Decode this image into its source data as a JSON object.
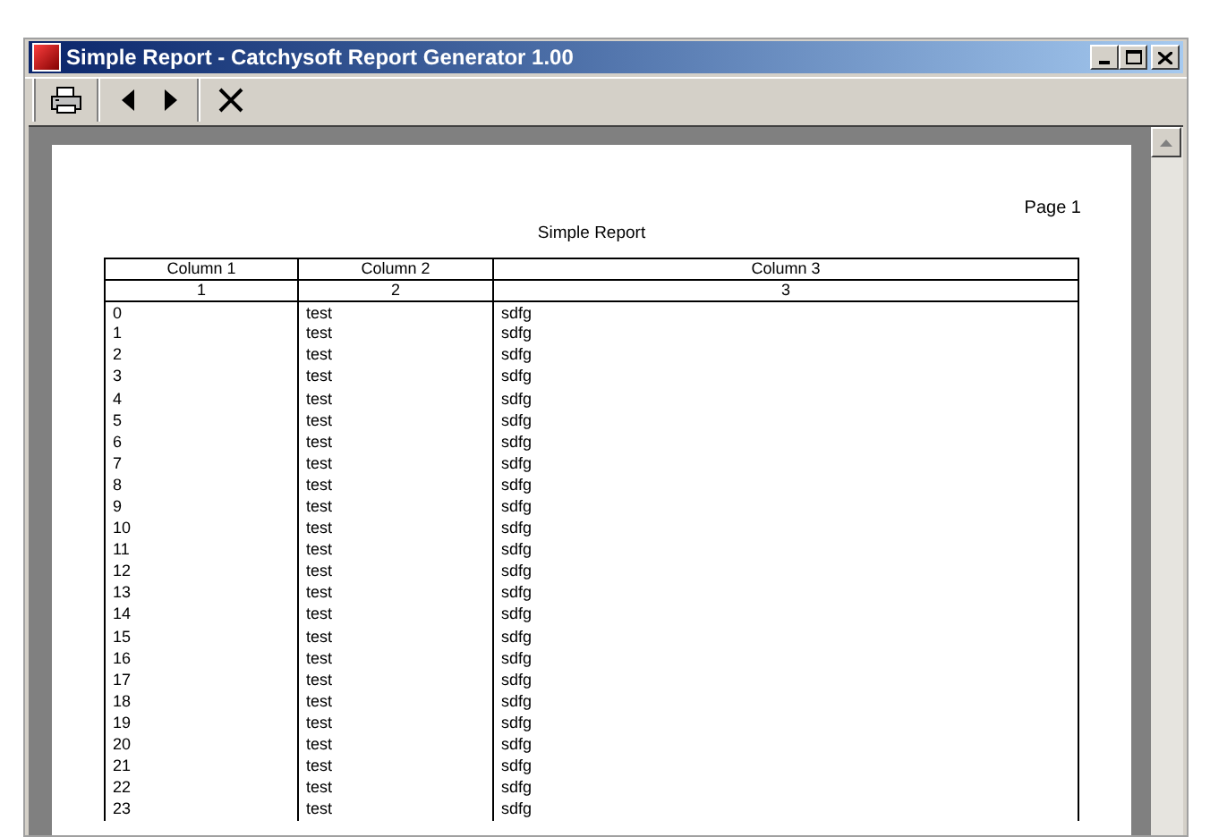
{
  "window": {
    "title": "Simple Report - Catchysoft Report Generator 1.00"
  },
  "report": {
    "page_label": "Page 1",
    "title": "Simple Report",
    "columns": [
      {
        "heading": "Column 1",
        "number": "1"
      },
      {
        "heading": "Column 2",
        "number": "2"
      },
      {
        "heading": "Column 3",
        "number": "3"
      }
    ],
    "rows": [
      [
        "0",
        "test",
        "sdfg"
      ],
      [
        "1",
        "test",
        "sdfg"
      ],
      [
        "2",
        "test",
        "sdfg"
      ],
      [
        "3",
        "test",
        "sdfg"
      ],
      [
        "4",
        "test",
        "sdfg"
      ],
      [
        "5",
        "test",
        "sdfg"
      ],
      [
        "6",
        "test",
        "sdfg"
      ],
      [
        "7",
        "test",
        "sdfg"
      ],
      [
        "8",
        "test",
        "sdfg"
      ],
      [
        "9",
        "test",
        "sdfg"
      ],
      [
        "10",
        "test",
        "sdfg"
      ],
      [
        "11",
        "test",
        "sdfg"
      ],
      [
        "12",
        "test",
        "sdfg"
      ],
      [
        "13",
        "test",
        "sdfg"
      ],
      [
        "14",
        "test",
        "sdfg"
      ],
      [
        "15",
        "test",
        "sdfg"
      ],
      [
        "16",
        "test",
        "sdfg"
      ],
      [
        "17",
        "test",
        "sdfg"
      ],
      [
        "18",
        "test",
        "sdfg"
      ],
      [
        "19",
        "test",
        "sdfg"
      ],
      [
        "20",
        "test",
        "sdfg"
      ],
      [
        "21",
        "test",
        "sdfg"
      ],
      [
        "22",
        "test",
        "sdfg"
      ],
      [
        "23",
        "test",
        "sdfg"
      ]
    ]
  }
}
